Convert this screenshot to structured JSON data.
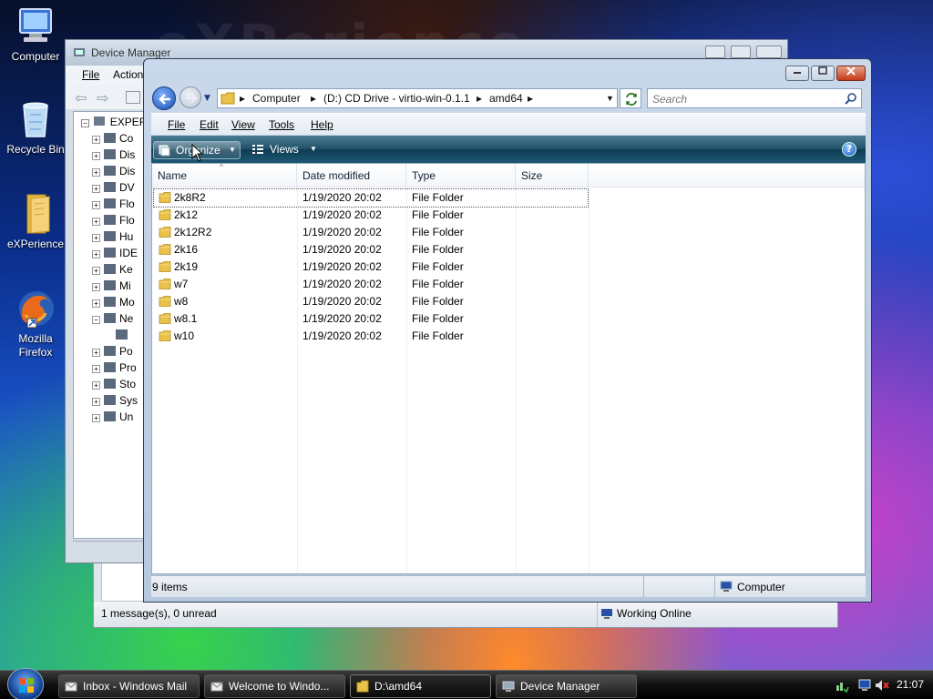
{
  "desktop": {
    "icons": [
      {
        "label": "Computer"
      },
      {
        "label": "Recycle Bin"
      },
      {
        "label": "eXPerience"
      },
      {
        "label": "Mozilla\nFirefox"
      }
    ],
    "wallpaper_text": "eXPerience"
  },
  "device_manager": {
    "title": "Device Manager",
    "menu": [
      "File",
      "Action"
    ],
    "tree_root": "EXPER",
    "tree_items": [
      "Co",
      "Dis",
      "Dis",
      "DV",
      "Flo",
      "Flo",
      "Hu",
      "IDE",
      "Ke",
      "Mi",
      "Mo",
      "Ne",
      "",
      "Po",
      "Pro",
      "Sto",
      "Sys",
      "Un"
    ]
  },
  "mail": {
    "status_left": "1 message(s), 0 unread",
    "status_right": "Working Online"
  },
  "explorer": {
    "address": {
      "seg1": "Computer",
      "seg2": "(D:) CD Drive - virtio-win-0.1.1",
      "seg3": "amd64"
    },
    "search_placeholder": "Search",
    "menu": {
      "file": "File",
      "edit": "Edit",
      "view": "View",
      "tools": "Tools",
      "help": "Help"
    },
    "commands": {
      "organize": "Organize",
      "views": "Views"
    },
    "columns": {
      "name": "Name",
      "date": "Date modified",
      "type": "Type",
      "size": "Size"
    },
    "files": [
      {
        "name": "2k8R2",
        "date": "1/19/2020 20:02",
        "type": "File Folder"
      },
      {
        "name": "2k12",
        "date": "1/19/2020 20:02",
        "type": "File Folder"
      },
      {
        "name": "2k12R2",
        "date": "1/19/2020 20:02",
        "type": "File Folder"
      },
      {
        "name": "2k16",
        "date": "1/19/2020 20:02",
        "type": "File Folder"
      },
      {
        "name": "2k19",
        "date": "1/19/2020 20:02",
        "type": "File Folder"
      },
      {
        "name": "w7",
        "date": "1/19/2020 20:02",
        "type": "File Folder"
      },
      {
        "name": "w8",
        "date": "1/19/2020 20:02",
        "type": "File Folder"
      },
      {
        "name": "w8.1",
        "date": "1/19/2020 20:02",
        "type": "File Folder"
      },
      {
        "name": "w10",
        "date": "1/19/2020 20:02",
        "type": "File Folder"
      }
    ],
    "status_items": "9 items",
    "status_location": "Computer"
  },
  "taskbar": {
    "tasks": [
      {
        "label": "Inbox - Windows Mail"
      },
      {
        "label": "Welcome to Windo..."
      },
      {
        "label": "D:\\amd64"
      },
      {
        "label": "Device Manager"
      }
    ],
    "clock": "21:07"
  },
  "colors": {
    "accent": "#1f4f68",
    "selection": "#3399ff",
    "folder": "#e8c24a"
  }
}
